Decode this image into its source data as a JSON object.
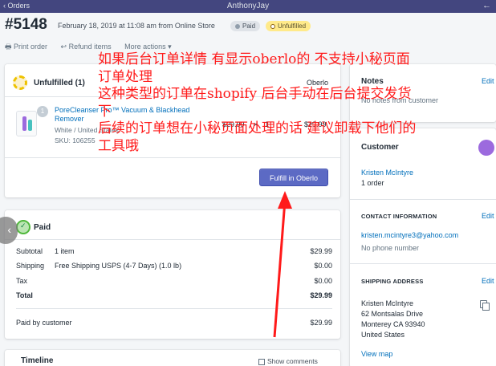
{
  "topbar": {
    "back_label": "‹ Orders",
    "shop_name": "AnthonyJay",
    "forward_icon": "arrow-right-icon"
  },
  "order": {
    "number": "#5148",
    "meta": "February 18, 2019 at 11:08 am from Online Store",
    "payment_badge": "Paid",
    "fulfillment_badge": "Unfulfilled"
  },
  "actions": {
    "print": "🖶 Print order",
    "refund": "↩ Refund items",
    "more": "More actions ▾"
  },
  "fulfillment_card": {
    "title": "Unfulfilled (1)",
    "vendor": "Oberlo",
    "item": {
      "quantity_bubble": "1",
      "name": "PoreCleanser Pro™ Vacuum & Blackhead Remover",
      "variant": "White / United States",
      "sku": "SKU: 106255",
      "unit_price": "$29.99",
      "times": "×",
      "qty": "1",
      "total": "$29.99"
    },
    "button": "Fulfill in Oberlo"
  },
  "payment_card": {
    "title": "Paid",
    "rows": [
      {
        "label": "Subtotal",
        "mid": "1 item",
        "value": "$29.99"
      },
      {
        "label": "Shipping",
        "mid": "Free Shipping USPS (4-7 Days) (1.0 lb)",
        "value": "$0.00"
      },
      {
        "label": "Tax",
        "mid": "",
        "value": "$0.00"
      },
      {
        "label": "Total",
        "mid": "",
        "value": "$29.99"
      },
      {
        "label": "Paid by customer",
        "mid": "",
        "value": "$29.99"
      }
    ]
  },
  "timeline": {
    "title": "Timeline",
    "show_comments": "Show comments"
  },
  "notes": {
    "title": "Notes",
    "edit": "Edit",
    "text": "No notes from customer"
  },
  "customer": {
    "title": "Customer",
    "name": "Kristen McIntyre",
    "orders": "1 order",
    "contact_title": "CONTACT INFORMATION",
    "contact_edit": "Edit",
    "email": "kristen.mcintyre3@yahoo.com",
    "phone": "No phone number",
    "shipping_title": "SHIPPING ADDRESS",
    "shipping_edit": "Edit",
    "address": [
      "Kristen McIntyre",
      "62 Montsalas Drive",
      "Monterey CA 93940",
      "United States"
    ],
    "view_map": "View map"
  },
  "annotation": {
    "lines": [
      "如果后台订单详情 有显示oberlo的 不支持小秘页面",
      "订单处理",
      "这种类型的订单在shopify 后台手动在后台提交发货",
      "下",
      "后续的订单想在小秘页面处理的话 建议卸载下他们的",
      "工具哦"
    ],
    "color": "#ff1a1a"
  },
  "colors": {
    "topbar": "#43467f",
    "primary": "#5c6ac4",
    "link": "#006fbb"
  }
}
